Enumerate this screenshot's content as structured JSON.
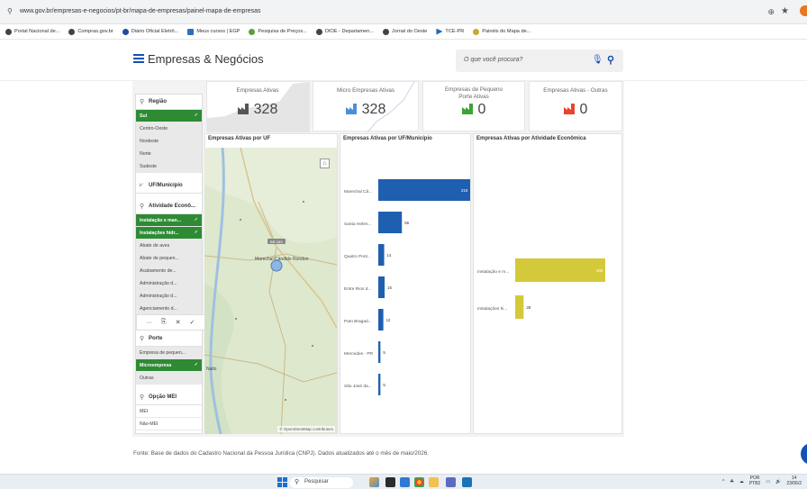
{
  "browser": {
    "url": "www.gov.br/empresas-e-negocios/pt-br/mapa-de-empresas/painel-mapa-de-empresas",
    "bookmarks": [
      {
        "label": "Portal Nacional de..."
      },
      {
        "label": "Compras.gov.br"
      },
      {
        "label": "Diário Oficial Eletrô..."
      },
      {
        "label": "Meus cursos | EGP"
      },
      {
        "label": "Pesquisa de Preços..."
      },
      {
        "label": "DIOE - Departamen..."
      },
      {
        "label": "Jornal do Oeste"
      },
      {
        "label": "TCE-PR"
      },
      {
        "label": "Painéis do Mapa de..."
      }
    ]
  },
  "header": {
    "title": "Empresas & Negócios",
    "search_placeholder": "O que você procura?"
  },
  "kpis": [
    {
      "title": "Empresas Ativas",
      "value": "328",
      "color": "#555555"
    },
    {
      "title": "Micro Empresas Ativas",
      "value": "328",
      "color": "#4a90d9"
    },
    {
      "title": "Empresas de Pequeno Porte Ativas",
      "value": "0",
      "color": "#3aa534"
    },
    {
      "title": "Empresas Ativas - Outras",
      "value": "0",
      "color": "#e8452c"
    }
  ],
  "filters": {
    "regiao": {
      "title": "Região",
      "items": [
        {
          "label": "Sul",
          "selected": true
        },
        {
          "label": "Centro-Oeste",
          "selected": false
        },
        {
          "label": "Nordeste",
          "selected": false
        },
        {
          "label": "Norte",
          "selected": false
        },
        {
          "label": "Sudeste",
          "selected": false
        }
      ]
    },
    "uf_municipio": {
      "title": "UF/Município"
    },
    "atividade": {
      "title": "Atividade Econô...",
      "items": [
        {
          "label": "Instalação e man...",
          "selected": true
        },
        {
          "label": "Instalações hidr...",
          "selected": true
        },
        {
          "label": "Abate de aves",
          "selected": false
        },
        {
          "label": "Abate de pequen...",
          "selected": false
        },
        {
          "label": "Acabamento de...",
          "selected": false
        },
        {
          "label": "Administração d...",
          "selected": false
        },
        {
          "label": "Administração d...",
          "selected": false
        },
        {
          "label": "Agenciamento d...",
          "selected": false
        }
      ]
    },
    "porte": {
      "title": "Porte",
      "items": [
        {
          "label": "Empresa de pequen...",
          "selected": false
        },
        {
          "label": "Microempresa",
          "selected": true
        },
        {
          "label": "Outras",
          "selected": false
        }
      ]
    },
    "opcao_mei": {
      "title": "Opção MEI",
      "items": [
        {
          "label": "MEI",
          "selected": false
        },
        {
          "label": "Não-MEI",
          "selected": false
        }
      ]
    }
  },
  "map": {
    "title": "Empresas Ativas por UF",
    "city_label": "Marechal Cândido Rondon",
    "road_label": "BR-163",
    "credit": "© OpenStreetMap contributors",
    "place_label": "Nailo"
  },
  "chart_municipio": {
    "title": "Empresas Ativas por UF/Município",
    "chart_data": {
      "type": "bar",
      "orientation": "horizontal",
      "categories": [
        "Marechal Câ...",
        "Santa Helen...",
        "Quatro Pont...",
        "Entre Rios d...",
        "Pato Bragad...",
        "Mercedes - PR",
        "São José da..."
      ],
      "values": [
        218,
        56,
        14,
        15,
        12,
        5,
        5
      ],
      "color": "#1f5fb0"
    }
  },
  "chart_atividade": {
    "title": "Empresas Ativas por Atividade Econômica",
    "chart_data": {
      "type": "bar",
      "orientation": "horizontal",
      "categories": [
        "Instalação e m...",
        "Instalações hi..."
      ],
      "values": [
        300,
        28
      ],
      "color": "#d4c93a"
    }
  },
  "footer_note": "Fonte: Base de dados do Cadastro Nacional da Pessoa Jurídica (CNPJ). Dados atualizados até o mês de maio/2026.",
  "taskbar": {
    "search_label": "Pesquisar",
    "lang_top": "POR",
    "lang_bottom": "PTB2",
    "time": "14",
    "date": "23/06/2"
  }
}
